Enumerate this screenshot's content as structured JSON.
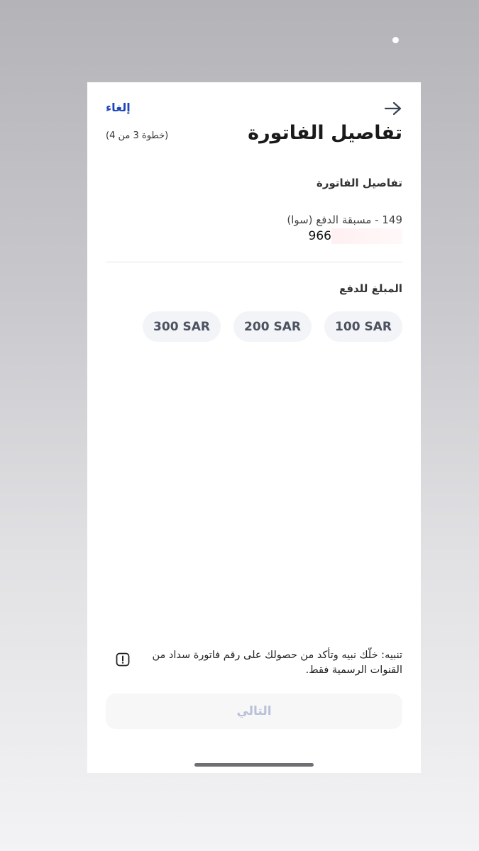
{
  "header": {
    "cancel_label": "إلغاء",
    "title": "تفاصيل الفاتورة",
    "step": "(خطوة 3 من 4)"
  },
  "bill": {
    "section_title": "تفاصيل الفاتورة",
    "type": "149 - مسبقة الدفع (سوا)",
    "number_visible": "966"
  },
  "amount": {
    "section_title": "المبلغ للدفع",
    "options": [
      "100 SAR",
      "200 SAR",
      "300 SAR"
    ]
  },
  "notice": {
    "text": "تنبيه: خلّك نبيه وتأكد من حصولك على رقم فاتورة سداد من القنوات الرسمية فقط."
  },
  "footer": {
    "next_label": "التالي"
  },
  "colors": {
    "accent": "#1e45b8",
    "chip_bg": "#f3f4f7",
    "disabled_text": "#b8c0d8"
  }
}
